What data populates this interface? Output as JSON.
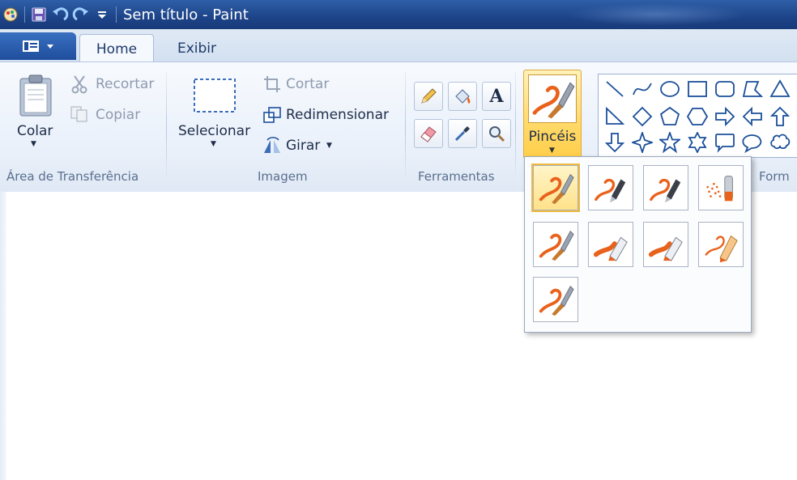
{
  "window": {
    "title": "Sem título - Paint"
  },
  "tabs": [
    {
      "label": "Home",
      "active": true
    },
    {
      "label": "Exibir",
      "active": false
    }
  ],
  "clipboard": {
    "paste_label": "Colar",
    "cut_label": "Recortar",
    "copy_label": "Copiar",
    "group_label": "Área de Transferência"
  },
  "image": {
    "select_label": "Selecionar",
    "crop_label": "Cortar",
    "resize_label": "Redimensionar",
    "rotate_label": "Girar",
    "group_label": "Imagem"
  },
  "tools": {
    "group_label": "Ferramentas",
    "items": [
      "pencil-icon",
      "fill-bucket-icon",
      "text-icon",
      "eraser-icon",
      "color-picker-icon",
      "magnifier-icon"
    ]
  },
  "brushes": {
    "label": "Pincéis",
    "selected_index": 0,
    "options": [
      "brush",
      "calligraphy-brush-1",
      "calligraphy-brush-2",
      "airbrush",
      "oil-brush",
      "crayon",
      "marker",
      "natural-pencil",
      "watercolor-brush"
    ]
  },
  "shapes": {
    "group_label_partial": "Form",
    "items": [
      "line",
      "curve",
      "oval",
      "rectangle",
      "rounded-rectangle",
      "polygon",
      "triangle",
      "right-triangle",
      "diamond",
      "pentagon",
      "hexagon",
      "arrow-right",
      "arrow-left",
      "arrow-up",
      "arrow-down",
      "star-4",
      "star-5",
      "star-6",
      "callout-rounded-rect",
      "callout-oval",
      "callout-cloud"
    ]
  },
  "colors": {
    "titlebar": "#1d4488",
    "accent": "#ffd96a",
    "brush_orange": "#e8621c"
  }
}
